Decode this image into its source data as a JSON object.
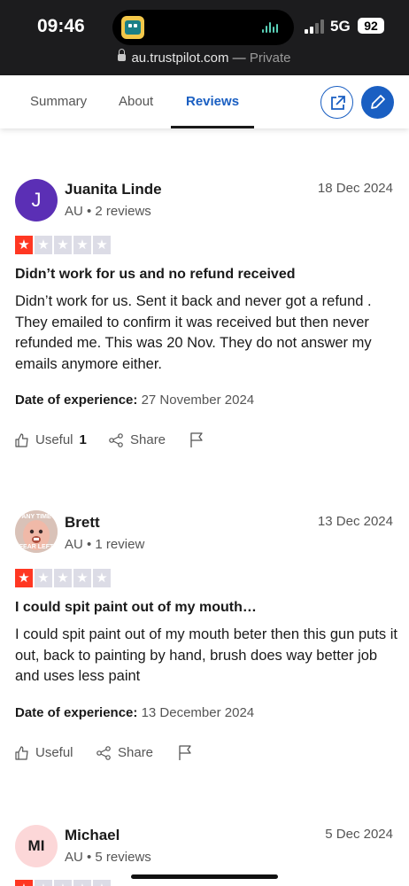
{
  "status_bar": {
    "time": "09:46",
    "network": "5G",
    "battery": "92"
  },
  "browser": {
    "host": "au.trustpilot.com",
    "separator": " — ",
    "mode": "Private"
  },
  "tabs": [
    {
      "label": "Summary",
      "active": false
    },
    {
      "label": "About",
      "active": false
    },
    {
      "label": "Reviews",
      "active": true
    }
  ],
  "header_actions": {
    "share_icon": "external-link-icon",
    "write_icon": "pencil-icon"
  },
  "colors": {
    "accent": "#1a5fc2",
    "star_on": "#ff3722",
    "star_off": "#dcdce6"
  },
  "reviews": [
    {
      "avatar_initial": "J",
      "avatar_color": "#5b2fb5",
      "name": "Juanita Linde",
      "meta": "AU • 2 reviews",
      "date": "18 Dec 2024",
      "rating": 1,
      "title": "Didn’t work for us and no refund received",
      "body": "Didn’t work for us. Sent it back and never got a refund . They emailed to confirm it was received but then never refunded me. This was 20 Nov. They do not answer my emails anymore either.",
      "experience_label": "Date of experience:",
      "experience_date": "27 November 2024",
      "useful_label": "Useful",
      "useful_count": "1",
      "share_label": "Share"
    },
    {
      "avatar_initial": "",
      "avatar_photo_text": [
        "ANY TIME",
        "FEAR LEFT"
      ],
      "name": "Brett",
      "meta": "AU • 1 review",
      "date": "13 Dec 2024",
      "rating": 1,
      "title": "I could spit paint out of my mouth…",
      "body": "I could spit paint out of my mouth beter then this gun puts it out, back to painting by hand, brush does way better job and uses less paint",
      "experience_label": "Date of experience:",
      "experience_date": "13 December 2024",
      "useful_label": "Useful",
      "useful_count": "",
      "share_label": "Share"
    },
    {
      "avatar_initial": "MI",
      "avatar_color": "#fcd7d8",
      "name": "Michael",
      "meta": "AU • 5 reviews",
      "date": "5 Dec 2024",
      "rating": 1
    }
  ]
}
